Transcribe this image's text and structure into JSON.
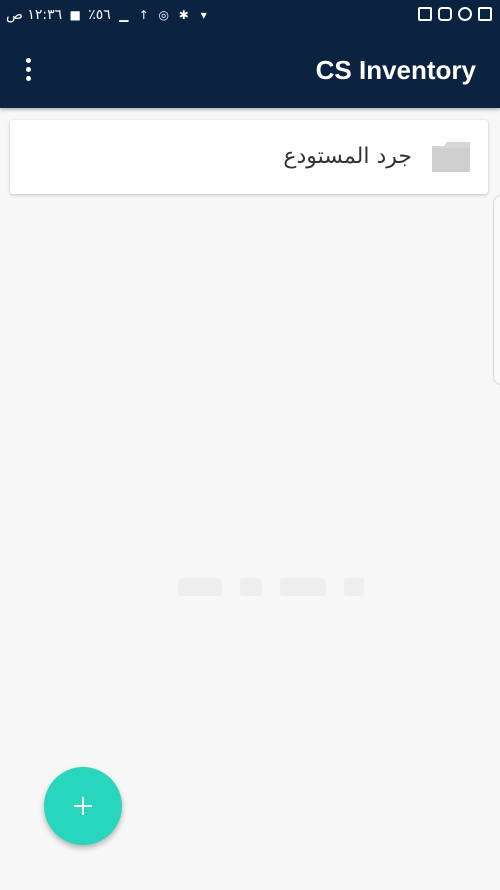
{
  "status_bar": {
    "time": "١٢:٣٦ ص",
    "battery_percent": "٪٥٦",
    "left_icons": [
      "lock-icon",
      "signal-icon",
      "wifi-icon",
      "alarm-icon",
      "bluetooth-icon",
      "location-icon"
    ],
    "right_icons": [
      "gallery-icon",
      "instagram-icon",
      "messenger-icon",
      "image-icon"
    ]
  },
  "app_bar": {
    "title": "CS Inventory",
    "menu_icon": "more-vert-icon",
    "background_color": "#0b2340"
  },
  "list": {
    "items": [
      {
        "label": "جرد المستودع",
        "icon": "folder-icon"
      }
    ]
  },
  "fab": {
    "icon": "plus-icon",
    "color": "#27d6bd"
  }
}
